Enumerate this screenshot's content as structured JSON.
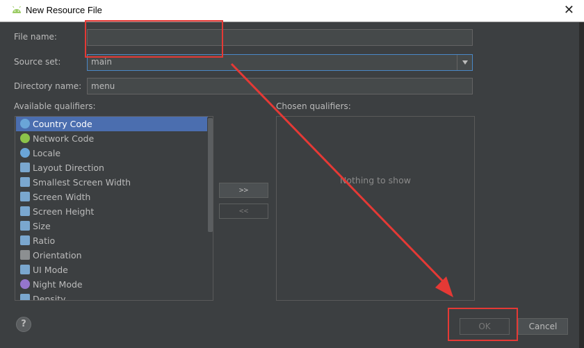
{
  "window": {
    "title": "New Resource File"
  },
  "form": {
    "file_name_label": "File name:",
    "file_name_value": "",
    "source_set_label": "Source set:",
    "source_set_value": "main",
    "directory_name_label": "Directory name:",
    "directory_name_value": "menu"
  },
  "available": {
    "label": "Available qualifiers:",
    "items": [
      {
        "label": "Country Code",
        "icon": "globe-icon",
        "selected": true
      },
      {
        "label": "Network Code",
        "icon": "network-icon"
      },
      {
        "label": "Locale",
        "icon": "globe-icon"
      },
      {
        "label": "Layout Direction",
        "icon": "layout-direction-icon"
      },
      {
        "label": "Smallest Screen Width",
        "icon": "smallest-width-icon"
      },
      {
        "label": "Screen Width",
        "icon": "screen-width-icon"
      },
      {
        "label": "Screen Height",
        "icon": "screen-height-icon"
      },
      {
        "label": "Size",
        "icon": "size-icon"
      },
      {
        "label": "Ratio",
        "icon": "ratio-icon"
      },
      {
        "label": "Orientation",
        "icon": "orientation-icon"
      },
      {
        "label": "UI Mode",
        "icon": "ui-mode-icon"
      },
      {
        "label": "Night Mode",
        "icon": "night-mode-icon"
      },
      {
        "label": "Density",
        "icon": "density-icon"
      }
    ]
  },
  "transfer": {
    "add_label": ">>",
    "remove_label": "<<"
  },
  "chosen": {
    "label": "Chosen qualifiers:",
    "empty_text": "Nothing to show"
  },
  "buttons": {
    "help": "?",
    "ok": "OK",
    "cancel": "Cancel"
  },
  "colors": {
    "selection": "#4b6eaf",
    "annotation_red": "#e53935",
    "dialog_bg": "#3c3f41"
  }
}
